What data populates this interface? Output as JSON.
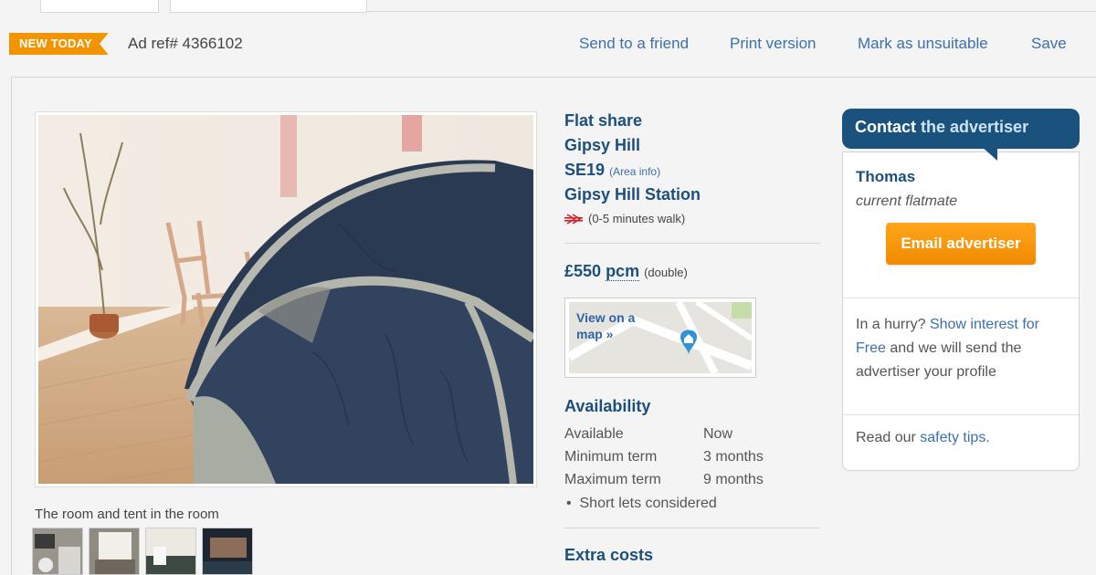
{
  "ad_bar": {
    "badge": "NEW TODAY",
    "ad_ref": "Ad ref# 4366102",
    "links": [
      "Send to a friend",
      "Print version",
      "Mark as unsuitable",
      "Save"
    ]
  },
  "photo": {
    "caption": "The room and tent in the room",
    "thumbnail_count": 4
  },
  "listing": {
    "type": "Flat share",
    "area": "Gipsy Hill",
    "postcode": "SE19",
    "area_info_link": "(Area info)",
    "station": "Gipsy Hill Station",
    "walk": "(0-5 minutes walk)",
    "price": "£550",
    "price_unit": "pcm",
    "room": "(double)"
  },
  "map": {
    "label": "View on a map »"
  },
  "availability": {
    "heading": "Availability",
    "rows": [
      {
        "key": "Available",
        "value": "Now"
      },
      {
        "key": "Minimum term",
        "value": "3 months"
      },
      {
        "key": "Maximum term",
        "value": "9 months"
      }
    ],
    "note": "Short lets considered"
  },
  "extra_costs": {
    "heading": "Extra costs"
  },
  "contact": {
    "heading_strong": "Contact",
    "heading_rest": "the advertiser",
    "name": "Thomas",
    "role": "current flatmate",
    "button": "Email advertiser",
    "hurry_prefix": "In a hurry?",
    "hurry_link": "Show interest for Free",
    "hurry_suffix": "and we will send the advertiser your profile",
    "safety_prefix": "Read our",
    "safety_link": "safety tips."
  },
  "colors": {
    "badge": "#f29400",
    "link": "#3d6fad",
    "heading": "#1d4f7d",
    "contact_header": "#1a527e",
    "button": "#f39200"
  }
}
